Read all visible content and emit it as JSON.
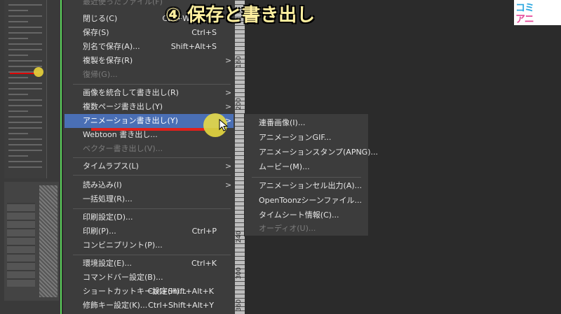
{
  "overlay": {
    "title": "④ 保存と書き出し",
    "logo_line1": "コミ",
    "logo_line2": "アニ"
  },
  "main_menu": {
    "items": [
      {
        "label": "最近使ったファイル(F)",
        "disabled": false
      },
      {
        "label": "閉じる(C)",
        "shortcut": "Ctrl+W"
      },
      {
        "label": "保存(S)",
        "shortcut": "Ctrl+S"
      },
      {
        "label": "別名で保存(A)...",
        "shortcut": "Shift+Alt+S"
      },
      {
        "label": "複製を保存(R)"
      },
      {
        "label": "復帰(G)...",
        "disabled": true
      },
      {
        "label": "画像を統合して書き出し(R)"
      },
      {
        "label": "複数ページ書き出し(Y)"
      },
      {
        "label": "アニメーション書き出し(Y)"
      },
      {
        "label": "Webtoon 書き出し..."
      },
      {
        "label": "ベクター書き出し(V)...",
        "disabled": true
      },
      {
        "label": "タイムラプス(L)"
      },
      {
        "label": "読み込み(I)"
      },
      {
        "label": "一括処理(R)..."
      },
      {
        "label": "印刷設定(D)..."
      },
      {
        "label": "印刷(P)...",
        "shortcut": "Ctrl+P"
      },
      {
        "label": "コンビニプリント(P)..."
      },
      {
        "label": "環境設定(E)...",
        "shortcut": "Ctrl+K"
      },
      {
        "label": "コマンドバー設定(B)..."
      },
      {
        "label": "ショートカットキー設定(H)...",
        "shortcut": "Ctrl+Shift+Alt+K"
      },
      {
        "label": "修飾キー設定(K)...",
        "shortcut": "Ctrl+Shift+Alt+Y"
      }
    ]
  },
  "sub_menu": {
    "items": [
      {
        "label": "連番画像(I)..."
      },
      {
        "label": "アニメーションGIF..."
      },
      {
        "label": "アニメーションスタンプ(APNG)..."
      },
      {
        "label": "ムービー(M)..."
      },
      {
        "label": "アニメーションセル出力(A)..."
      },
      {
        "label": "OpenToonzシーンファイル..."
      },
      {
        "label": "タイムシート情報(C)..."
      },
      {
        "label": "オーディオ(U)...",
        "disabled": true
      }
    ]
  },
  "ruler": {
    "labels": [
      "160",
      "200",
      "240",
      "300",
      "360"
    ]
  },
  "colors": {
    "highlight": "#4a6fb5",
    "annotation_red": "#e0201c",
    "cursor_yellow": "#f0e040",
    "title_text": "#fff0a0"
  }
}
